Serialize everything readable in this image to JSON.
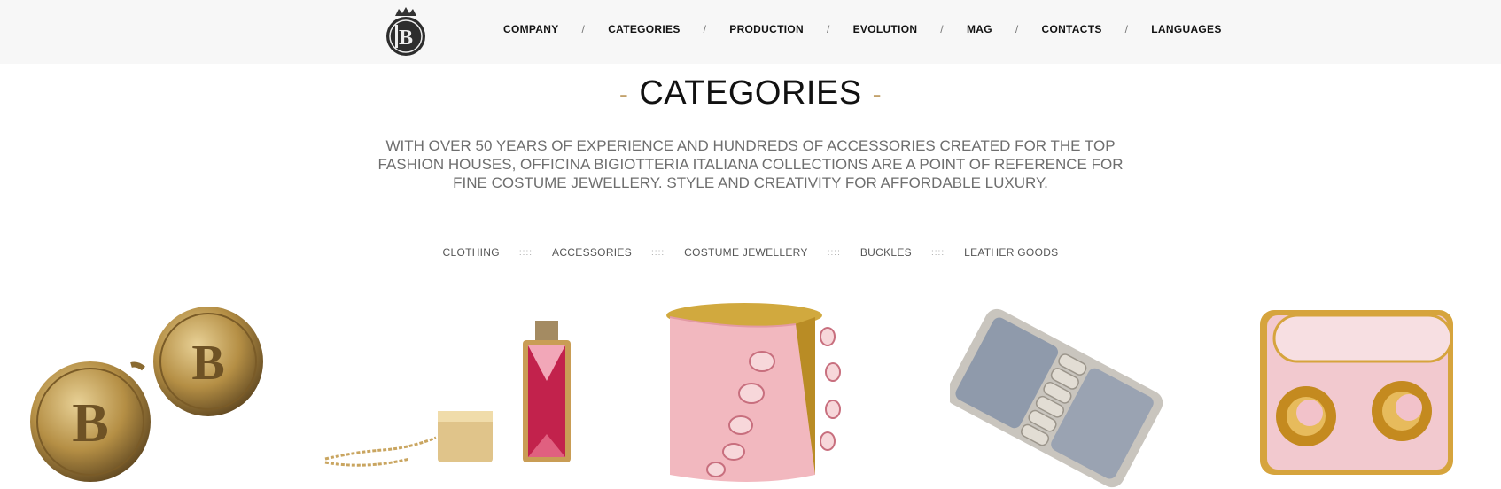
{
  "header": {
    "logo_alt": "OBI monogram logo",
    "nav": [
      {
        "label": "COMPANY"
      },
      {
        "label": "CATEGORIES"
      },
      {
        "label": "PRODUCTION"
      },
      {
        "label": "EVOLUTION"
      },
      {
        "label": "MAG"
      },
      {
        "label": "CONTACTS"
      },
      {
        "label": "LANGUAGES"
      }
    ],
    "separator": "/"
  },
  "main": {
    "title": "CATEGORIES",
    "title_dash": "-",
    "intro": "WITH OVER 50 YEARS OF EXPERIENCE AND HUNDREDS OF ACCESSORIES CREATED FOR THE TOP FASHION HOUSES, OFFICINA BIGIOTTERIA ITALIANA COLLECTIONS ARE A POINT OF REFERENCE FOR FINE COSTUME JEWELLERY. STYLE AND CREATIVITY FOR AFFORDABLE LUXURY.",
    "filters": [
      {
        "label": "CLOTHING"
      },
      {
        "label": "ACCESSORIES"
      },
      {
        "label": "COSTUME JEWELLERY"
      },
      {
        "label": "BUCKLES"
      },
      {
        "label": "LEATHER GOODS"
      }
    ],
    "filter_separator": "::::"
  },
  "products": [
    {
      "icon": "gold-buttons-icon"
    },
    {
      "icon": "usb-keychain-icon"
    },
    {
      "icon": "pink-cuff-bracelet-icon"
    },
    {
      "icon": "marble-buckle-icon"
    },
    {
      "icon": "pink-clasp-icon"
    }
  ],
  "colors": {
    "topbar_bg": "#f7f7f7",
    "accent_gold": "#c2a16b",
    "text_gray": "#6e6e6e"
  }
}
